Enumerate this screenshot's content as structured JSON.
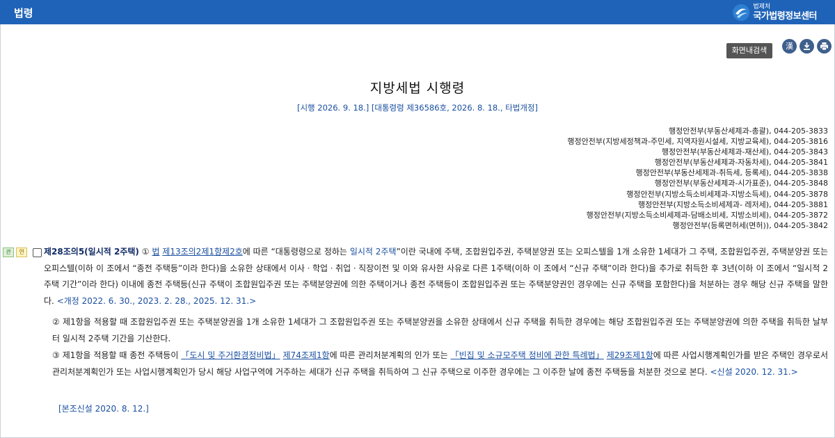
{
  "header": {
    "section_title": "법령",
    "logo_small": "법제처",
    "logo_big": "국가법령정보센터"
  },
  "toolbar": {
    "search_label": "화면내검색",
    "hanja_label": "漢"
  },
  "document": {
    "title": "지방세법 시행령",
    "subinfo": "[시행 2026. 9. 18.] [대통령령 제36586호, 2026. 8. 18., 타법개정]",
    "contacts": [
      "행정안전부(부동산세제과-총괄), 044-205-3833",
      "행정안전부(지방세정책과-주민세, 지역자원시설세, 지방교육세), 044-205-3816",
      "행정안전부(부동산세제과-재산세), 044-205-3843",
      "행정안전부(부동산세제과-자동차세), 044-205-3841",
      "행정안전부(부동산세제과-취득세, 등록세), 044-205-3838",
      "행정안전부(부동산세제과-시가표준), 044-205-3848",
      "행정안전부(지방소득소비세제과-지방소득세), 044-205-3878",
      "행정안전부(지방소득소비세제과- 레저세), 044-205-3881",
      "행정안전부(지방소득소비세제과-담배소비세, 지방소비세), 044-205-3872",
      "행정안전부(등록면허세(면허)), 044-205-3842"
    ]
  },
  "article": {
    "badge_1": "관",
    "badge_2": "연",
    "heading": "제28조의5(일시적 2주택)",
    "p1_a": "① ",
    "p1_law": "법",
    "p1_b": " ",
    "p1_ref1": "제13조의2",
    "p1_ref2": "제1항",
    "p1_ref3": "제2호",
    "p1_c": "에 따른 “대통령령으로 정하는 ",
    "p1_d": "일시적 2주택",
    "p1_e": "”이란 국내에 주택, 조합원입주권, 주택분양권 또는 오피스텔을 1개 소유한 1세대가 그 주택, 조합원입주권, 주택분양권 또는 오피스텔(이하 이 조에서 “종전 주택등”이라 한다)을 소유한 상태에서 이사ㆍ학업ㆍ취업ㆍ직장이전 및 이와 유사한 사유로 다른 1주택(이하 이 조에서 “신규 주택”이라 한다)을 추가로 취득한 후 3년(이하 이 조에서 “일시적 2주택 기간”이라 한다) 이내에 종전 주택등(신규 주택이 조합원입주권 또는 주택분양권에 의한 주택이거나 종전 주택등이 조합원입주권 또는 주택분양권인 경우에는 신규 주택을 포함한다)을 처분하는 경우 해당 신규 주택을 말한다.",
    "p1_amend": "<개정 2022. 6. 30., 2023. 2. 28., 2025. 12. 31.>",
    "p2": "② 제1항을 적용할 때 조합원입주권 또는 주택분양권을 1개 소유한 1세대가 그 조합원입주권 또는 주택분양권을 소유한 상태에서 신규 주택을 취득한 경우에는 해당 조합원입주권 또는 주택분양권에 의한 주택을 취득한 날부터 일시적 2주택 기간을 기산한다.",
    "p3_a": "③ 제1항을 적용할 때 종전 주택등이 ",
    "p3_law1": "「도시 및 주거환경정비법」",
    "p3_b": " ",
    "p3_ref1": "제74조",
    "p3_ref2": "제1항",
    "p3_c": "에 따른 관리처분계획의 인가 또는 ",
    "p3_law2": "「빈집 및 소규모주택 정비에 관한 특례법」",
    "p3_d": " ",
    "p3_ref3": "제29조",
    "p3_ref4": "제1항",
    "p3_e": "에 따른 사업시행계획인가를 받은 주택인 경우로서 관리처분계획인가 또는 사업시행계획인가 당시 해당 사업구역에 거주하는 세대가 신규 주택을 취득하여 그 신규 주택으로 이주한 경우에는 그 이주한 날에 종전 주택등을 처분한 것으로 본다.",
    "p3_amend": "<신설 2020. 12. 31.>",
    "note": "[본조신설 2020. 8. 12.]"
  }
}
